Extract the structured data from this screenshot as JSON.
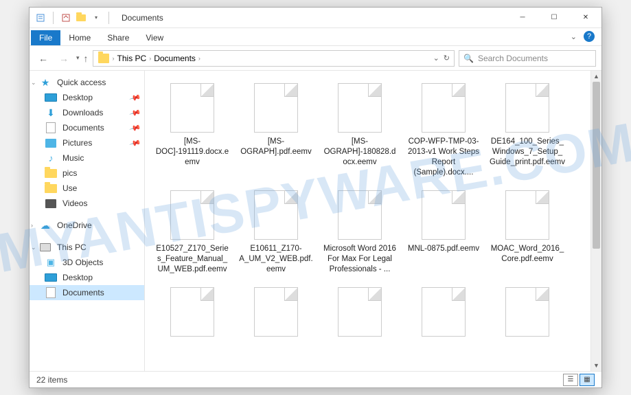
{
  "watermark": "MYANTISPYWARE.COM",
  "window": {
    "title": "Documents"
  },
  "ribbon": {
    "file": "File",
    "tabs": [
      "Home",
      "Share",
      "View"
    ]
  },
  "breadcrumb": {
    "items": [
      "This PC",
      "Documents"
    ],
    "refresh_icon": "↻"
  },
  "search": {
    "placeholder": "Search Documents"
  },
  "sidebar": {
    "quick_access": {
      "label": "Quick access",
      "items": [
        {
          "label": "Desktop",
          "icon": "desktop",
          "pinned": true
        },
        {
          "label": "Downloads",
          "icon": "downloads",
          "pinned": true
        },
        {
          "label": "Documents",
          "icon": "docs",
          "pinned": true
        },
        {
          "label": "Pictures",
          "icon": "pics",
          "pinned": true
        },
        {
          "label": "Music",
          "icon": "music",
          "pinned": false
        },
        {
          "label": "pics",
          "icon": "folder",
          "pinned": false
        },
        {
          "label": "Use",
          "icon": "folder",
          "pinned": false
        },
        {
          "label": "Videos",
          "icon": "videos",
          "pinned": false
        }
      ]
    },
    "onedrive": {
      "label": "OneDrive"
    },
    "thispc": {
      "label": "This PC",
      "items": [
        {
          "label": "3D Objects",
          "icon": "3d"
        },
        {
          "label": "Desktop",
          "icon": "desktop"
        },
        {
          "label": "Documents",
          "icon": "docs",
          "selected": true
        }
      ]
    }
  },
  "files": [
    {
      "name": "[MS-DOC]-191119.docx.eemv"
    },
    {
      "name": "[MS-OGRAPH].pdf.eemv"
    },
    {
      "name": "[MS-OGRAPH]-180828.docx.eemv"
    },
    {
      "name": "COP-WFP-TMP-03-2013-v1 Work Steps Report (Sample).docx...."
    },
    {
      "name": "DE164_100_Series_Windows_7_Setup_Guide_print.pdf.eemv"
    },
    {
      "name": "E10527_Z170_Series_Feature_Manual_UM_WEB.pdf.eemv"
    },
    {
      "name": "E10611_Z170-A_UM_V2_WEB.pdf.eemv"
    },
    {
      "name": "Microsoft Word 2016 For Max For Legal Professionals - ..."
    },
    {
      "name": "MNL-0875.pdf.eemv"
    },
    {
      "name": "MOAC_Word_2016_Core.pdf.eemv"
    },
    {
      "name": ""
    },
    {
      "name": ""
    },
    {
      "name": ""
    },
    {
      "name": ""
    },
    {
      "name": ""
    }
  ],
  "status": {
    "item_count": "22 items"
  }
}
